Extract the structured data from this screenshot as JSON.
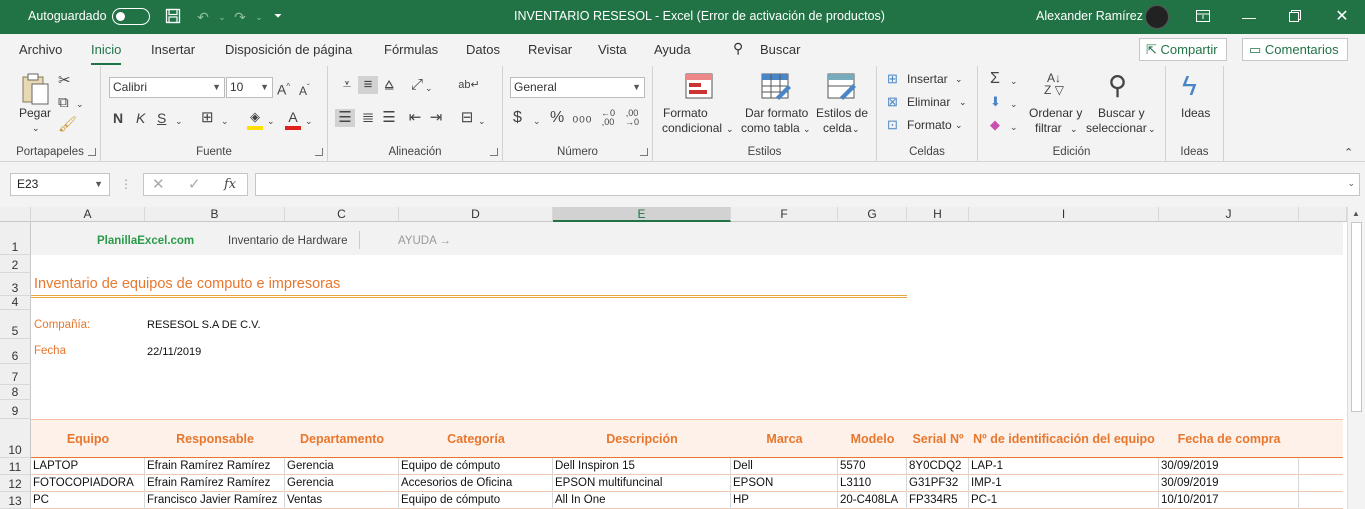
{
  "titlebar": {
    "autosave_label": "Autoguardado",
    "document_title": "INVENTARIO RESESOL  -  Excel (Error de activación de productos)",
    "user_name": "Alexander Ramírez",
    "colors": {
      "brand": "#217346"
    }
  },
  "menu": {
    "tabs": [
      "Archivo",
      "Inicio",
      "Insertar",
      "Disposición de página",
      "Fórmulas",
      "Datos",
      "Revisar",
      "Vista",
      "Ayuda"
    ],
    "active_tab": "Inicio",
    "search_label": "Buscar",
    "share_label": "Compartir",
    "comments_label": "Comentarios"
  },
  "ribbon": {
    "groups": {
      "clipboard": "Portapapeles",
      "font": "Fuente",
      "alignment": "Alineación",
      "number": "Número",
      "styles": "Estilos",
      "cells": "Celdas",
      "editing": "Edición",
      "ideas": "Ideas"
    },
    "paste_label": "Pegar",
    "font_name": "Calibri",
    "font_size": "10",
    "bold": "N",
    "italic": "K",
    "underline": "S",
    "number_format": "General",
    "conditional_format": [
      "Formato",
      "condicional"
    ],
    "format_as_table": [
      "Dar formato",
      "como tabla"
    ],
    "cell_styles": [
      "Estilos de",
      "celda"
    ],
    "insert_label": "Insertar",
    "delete_label": "Eliminar",
    "format_label": "Formato",
    "sort_filter": [
      "Ordenar y",
      "filtrar"
    ],
    "find_select": [
      "Buscar y",
      "seleccionar"
    ],
    "ideas_label": "Ideas"
  },
  "formula_bar": {
    "name_box": "E23",
    "formula": ""
  },
  "grid": {
    "columns": [
      "A",
      "B",
      "C",
      "D",
      "E",
      "F",
      "G",
      "H",
      "I",
      "J"
    ],
    "selected_column": "E",
    "rows": [
      "1",
      "2",
      "3",
      "4",
      "5",
      "6",
      "7",
      "8",
      "9",
      "10",
      "11",
      "12",
      "13"
    ],
    "header_links": {
      "site": "PlanillaExcel.com",
      "inventory": "Inventario de Hardware",
      "help": "AYUDA →"
    },
    "title": "Inventario de equipos de computo e impresoras",
    "company_label": "Compañía:",
    "company_value": "RESESOL S.A DE C.V.",
    "date_label": "Fecha",
    "date_value": "22/11/2019",
    "table_headers": [
      "Equipo",
      "Responsable",
      "Departamento",
      "Categoría",
      "Descripción",
      "Marca",
      "Modelo",
      "Serial Nº",
      "Nº de identificación del equipo",
      "Fecha de compra"
    ],
    "table_rows": [
      [
        "LAPTOP",
        "Efrain Ramírez Ramírez",
        "Gerencia",
        "Equipo de cómputo",
        "Dell Inspiron 15",
        "Dell",
        "5570",
        "8Y0CDQ2",
        "LAP-1",
        "30/09/2019"
      ],
      [
        "FOTOCOPIADORA",
        "Efrain Ramírez Ramírez",
        "Gerencia",
        "Accesorios de Oficina",
        "EPSON multifuncinal",
        "EPSON",
        "L3110",
        "G31PF32",
        "IMP-1",
        "30/09/2019"
      ],
      [
        "PC",
        "Francisco Javier Ramírez",
        "Ventas",
        "Equipo de cómputo",
        "All In One",
        "HP",
        "20-C408LA",
        "FP334R5",
        "PC-1",
        "10/10/2017"
      ]
    ],
    "colors": {
      "accent": "#e8772e",
      "link": "#217346"
    }
  }
}
